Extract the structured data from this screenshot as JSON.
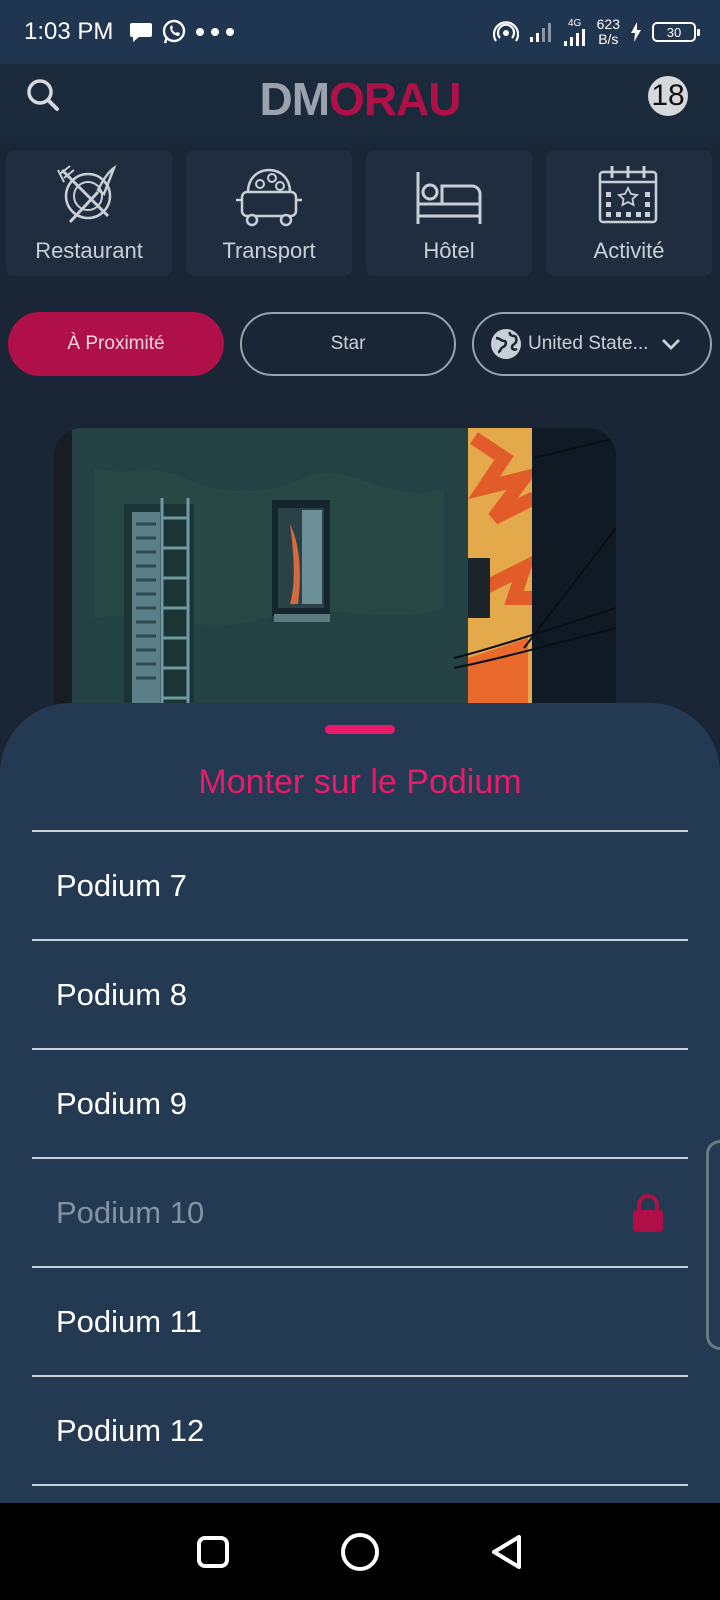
{
  "status_bar": {
    "time": "1:03 PM",
    "net_speed_value": "623",
    "net_speed_unit": "B/s",
    "network_type": "4G",
    "battery": "30"
  },
  "header": {
    "logo_part1": "DM",
    "logo_part2": "ORAU",
    "badge_count": "18"
  },
  "categories": [
    {
      "label": "Restaurant",
      "icon": "restaurant-icon"
    },
    {
      "label": "Transport",
      "icon": "transport-icon"
    },
    {
      "label": "Hôtel",
      "icon": "hotel-icon"
    },
    {
      "label": "Activité",
      "icon": "activity-calendar-icon"
    }
  ],
  "filters": {
    "nearby": "À Proximité",
    "star": "Star",
    "country": "United State..."
  },
  "sheet": {
    "title": "Monter sur le Podium",
    "items": [
      {
        "label": "Podium 7",
        "locked": false
      },
      {
        "label": "Podium 8",
        "locked": false
      },
      {
        "label": "Podium 9",
        "locked": false
      },
      {
        "label": "Podium 10",
        "locked": true
      },
      {
        "label": "Podium 11",
        "locked": false
      },
      {
        "label": "Podium 12",
        "locked": false
      }
    ]
  },
  "colors": {
    "accent": "#ea1a6a",
    "brand_red": "#b01048",
    "sheet_bg": "#233a52",
    "page_bg": "#1a2535"
  }
}
